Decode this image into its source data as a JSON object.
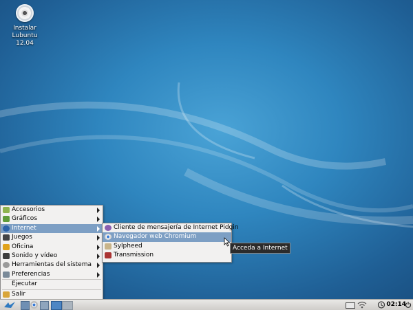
{
  "desktop": {
    "icon_line1": "Instalar",
    "icon_line2": "Lubuntu 12.04"
  },
  "main_menu": {
    "items": [
      {
        "label": "Accesorios",
        "icon": "accessories-icon"
      },
      {
        "label": "Gráficos",
        "icon": "graphics-icon"
      },
      {
        "label": "Internet",
        "icon": "internet-globe-icon"
      },
      {
        "label": "Juegos",
        "icon": "games-icon"
      },
      {
        "label": "Oficina",
        "icon": "office-icon"
      },
      {
        "label": "Sonido y vídeo",
        "icon": "sound-video-icon"
      },
      {
        "label": "Herramientas del sistema",
        "icon": "system-tools-icon"
      },
      {
        "label": "Preferencias",
        "icon": "preferences-icon"
      },
      {
        "label": "Ejecutar"
      },
      {
        "label": "Salir",
        "icon": "logout-icon"
      }
    ]
  },
  "sub_menu": {
    "items": [
      {
        "label": "Cliente de mensajería de Internet Pidgin",
        "icon": "pidgin-icon"
      },
      {
        "label": "Navegador web Chromium",
        "icon": "chromium-icon"
      },
      {
        "label": "Sylpheed",
        "icon": "sylpheed-mail-icon"
      },
      {
        "label": "Transmission",
        "icon": "transmission-icon"
      }
    ]
  },
  "tooltip": "Acceda a Internet",
  "panel": {
    "clock": "02:14"
  },
  "colors": {
    "menu_highlight": "#7d9fc4",
    "desktop_blue": "#2f86bf"
  }
}
